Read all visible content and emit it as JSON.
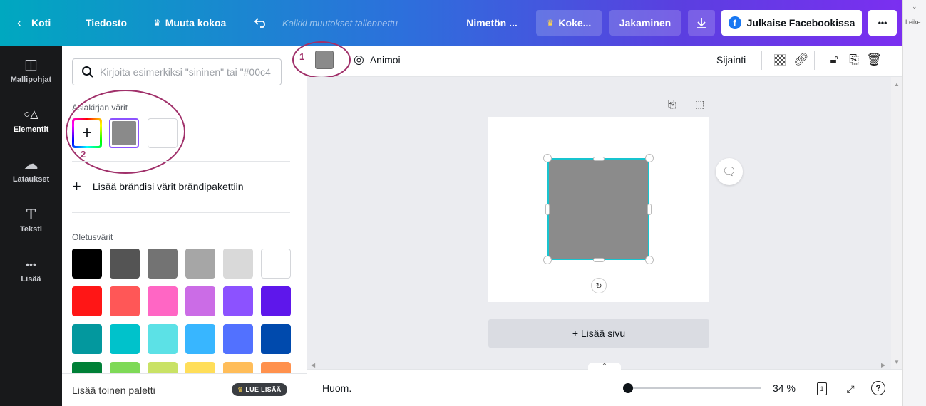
{
  "topbar": {
    "home": "Koti",
    "file": "Tiedosto",
    "resize": "Muuta kokoa",
    "save_status": "Kaikki muutokset tallennettu",
    "doc_name": "Nimetön ...",
    "try_pro": "Koke...",
    "share": "Jakaminen",
    "publish_fb": "Julkaise Facebookissa",
    "more": "•••",
    "edge_label": "Leike"
  },
  "rail": {
    "items": [
      {
        "label": "Mallipohjat",
        "icon": "template-icon"
      },
      {
        "label": "Elementit",
        "icon": "elements-icon"
      },
      {
        "label": "Lataukset",
        "icon": "upload-icon"
      },
      {
        "label": "Teksti",
        "icon": "text-icon"
      },
      {
        "label": "Lisää",
        "icon": "more-icon"
      }
    ]
  },
  "panel": {
    "search_placeholder": "Kirjoita esimerkiksi \"sininen\" tai \"#00c4",
    "doc_colors_label": "Asiakirjan värit",
    "add_brand": "Lisää brändisi värit brändipakettiin",
    "default_colors_label": "Oletusvärit",
    "document_colors": [
      "#8a8a8a",
      "#ffffff"
    ],
    "default_colors": [
      "#000000",
      "#545454",
      "#737373",
      "#a6a6a6",
      "#d9d9d9",
      "#ffffff",
      "#ff1616",
      "#ff5757",
      "#ff66c4",
      "#cb6ce6",
      "#8c52ff",
      "#5e17eb",
      "#03989e",
      "#00c2cb",
      "#5ce1e6",
      "#38b6ff",
      "#5271ff",
      "#004aad",
      "#008037",
      "#7ed957",
      "#c9e265",
      "#ffde59",
      "#ffbd59",
      "#ff914d"
    ],
    "footer_label": "Lisää toinen paletti",
    "footer_badge": "LUE LISÄÄ"
  },
  "annotations": {
    "one": "1",
    "two": "2",
    "color": "#a0306a"
  },
  "context_toolbar": {
    "animate": "Animoi",
    "position": "Sijainti",
    "current_color": "#8a8a8a"
  },
  "canvas": {
    "add_page": "+ Lisää sivu",
    "shape_color": "#8b8b8b",
    "selection_color": "#18c4cf"
  },
  "bottombar": {
    "notes": "Huom.",
    "zoom": "34 %",
    "page_count": "1"
  }
}
